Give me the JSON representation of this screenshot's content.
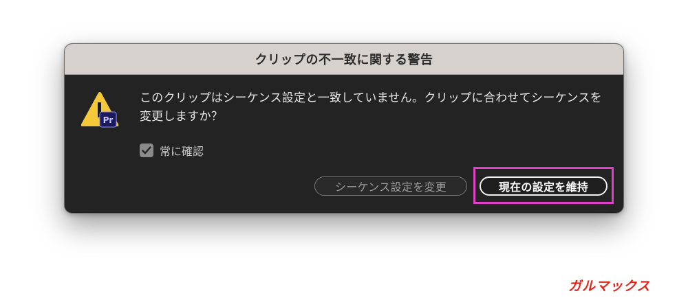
{
  "dialog": {
    "title": "クリップの不一致に関する警告",
    "message": "このクリップはシーケンス設定と一致していません。クリップに合わせてシーケンスを変更しますか？",
    "checkbox": {
      "label": "常に確認",
      "checked": true
    },
    "buttons": {
      "change_sequence": "シーケンス設定を変更",
      "keep_settings": "現在の設定を維持"
    },
    "icon": {
      "name": "warning-premiere-icon",
      "badge_text": "Pr",
      "warning_color": "#f5c83a",
      "badge_color": "#1b1a5e"
    }
  },
  "annotation": {
    "highlight_color": "#e03fc8"
  },
  "watermark": {
    "text": "ガルマックス",
    "color": "#e2231a"
  }
}
